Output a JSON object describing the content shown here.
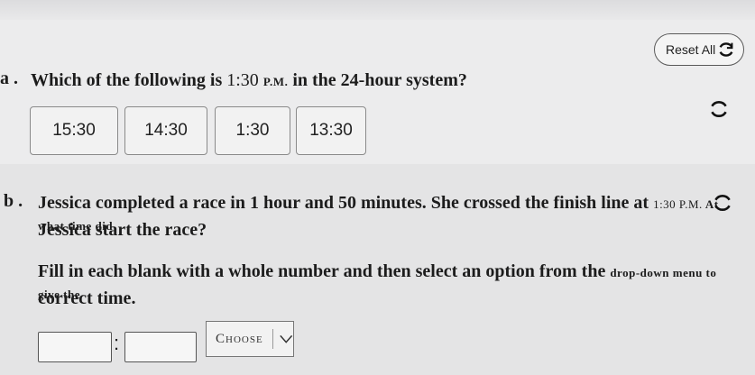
{
  "reset": {
    "label": "Reset All"
  },
  "part_a": {
    "label": "a .",
    "question_pre": "Which of the following is ",
    "question_time": "1:30",
    "question_pm": "P.M.",
    "question_post": " in the 24-hour system?",
    "choices": [
      "15:30",
      "14:30",
      "1:30",
      "13:30"
    ]
  },
  "part_b": {
    "label": "b .",
    "line1_main": "Jessica completed a race in 1 hour and 50 minutes. She crossed the finish line at ",
    "line1_small_time": "1:30 P.M.",
    "line1_small_rest": " At what time did",
    "line2": "Jessica start the race?",
    "instr1_main": "Fill in each blank with a whole number and then select an option from the ",
    "instr1_small": "drop-down menu to give the",
    "instr2": "correct time.",
    "colon": ":",
    "dropdown_label": "Choose"
  },
  "icons": {
    "reset": "refresh-icon",
    "dropdown": "chevron-down-icon"
  }
}
